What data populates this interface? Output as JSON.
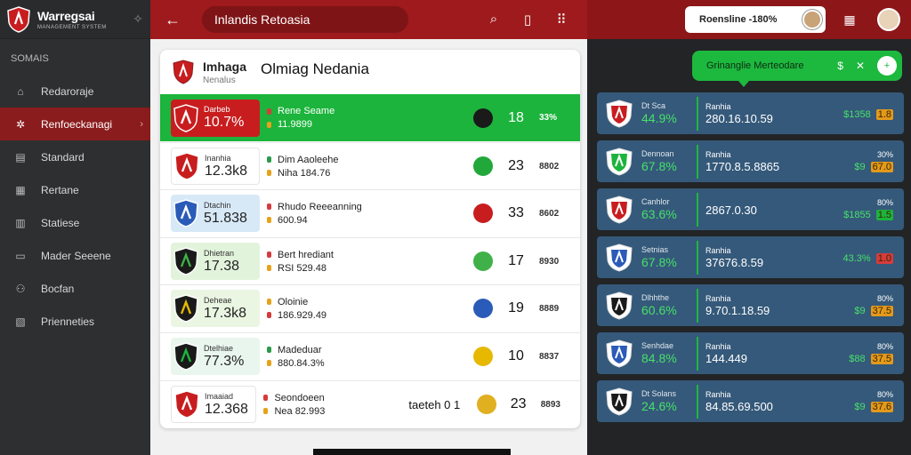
{
  "app": {
    "title": "Warregsai",
    "subtitle": "MANAGEMENT SYSTEM",
    "pulse_icon": "activity-icon"
  },
  "sidebar": {
    "section": "SOMAIS",
    "items": [
      {
        "label": "Redaroraje",
        "icon": "home-icon"
      },
      {
        "label": "Renfoeckanagi",
        "icon": "settings-icon",
        "active": true
      },
      {
        "label": "Standard",
        "icon": "document-icon"
      },
      {
        "label": "Rertane",
        "icon": "calendar-icon"
      },
      {
        "label": "Statiese",
        "icon": "chart-icon"
      },
      {
        "label": "Mader Seeene",
        "icon": "bookmark-icon"
      },
      {
        "label": "Bocfan",
        "icon": "users-icon"
      },
      {
        "label": "Prienneties",
        "icon": "clipboard-icon"
      }
    ]
  },
  "topbar": {
    "back_icon": "arrow-left-icon",
    "search_text": "Inlandis Retoasia",
    "icons": [
      "search-icon",
      "bookmark-icon",
      "grid-icon"
    ]
  },
  "topright": {
    "pill_text": "Roensline -180%",
    "accent": "#9e1a1c"
  },
  "card": {
    "head_title": "Imhaga",
    "head_sub": "Nenalus",
    "head_main": "Olmiag Nedania",
    "rows": [
      {
        "box_small": "Darbeb",
        "box_big": "10.7%",
        "l1": "Rene Seame",
        "l2": "11.9899",
        "score": "18",
        "tail": "33%",
        "ball": "#1a1a1a",
        "highlight": true
      },
      {
        "box_small": "Inanhia",
        "box_big": "12.3k8",
        "l1": "Dim Aaoleehe",
        "l2": "Niha 184.76",
        "score": "23",
        "tail": "8802",
        "ball": "#22a83a"
      },
      {
        "box_small": "Dtachin",
        "box_big": "51.838",
        "l1": "Rhudo Reeeanning",
        "l2": "600.94",
        "score": "33",
        "tail": "8602",
        "ball": "#c81d1f"
      },
      {
        "box_small": "Dhietran",
        "box_big": "17.38",
        "l1": "Bert hrediant",
        "l2": "RSI 529.48",
        "score": "17",
        "tail": "8930",
        "ball": "#3fb148"
      },
      {
        "box_small": "Deheae",
        "box_big": "17.3k8",
        "l1": "Oloinie",
        "l2": "186.929.49",
        "score": "19",
        "tail": "8889",
        "ball": "#2b5bb8"
      },
      {
        "box_small": "Dtelhiae",
        "box_big": "77.3%",
        "l1": "Madeduar",
        "l2": "880.84.3%",
        "score": "10",
        "tail": "8837",
        "ball": "#e6b800"
      },
      {
        "box_small": "Imaaiad",
        "box_big": "12.368",
        "l1": "Seondoeen",
        "l2": "Nea 82.993",
        "score": "23",
        "tail": "8893",
        "ball": "#e0b020",
        "extra": "taeteh  0   1"
      }
    ]
  },
  "rpanel": {
    "pill_text": "Grinanglie Merteodare",
    "pill_icons": [
      "dollar-icon",
      "close-icon",
      "plus-icon"
    ],
    "cards": [
      {
        "s1": "Dt Sca",
        "b1": "44.9%",
        "s2": "Ranhia",
        "b2": "280.16.10.59",
        "s3": "",
        "v1": "$1358",
        "v2": "1.8",
        "accent": "orange"
      },
      {
        "s1": "Dennoan",
        "b1": "67.8%",
        "s2": "Ranhia",
        "b2": "1770.8.5.8865",
        "s3": "30%",
        "v1": "$9",
        "v2": "67.0",
        "accent": "orange"
      },
      {
        "s1": "Canhlor",
        "b1": "63.6%",
        "s2": "",
        "b2": "2867.0.30",
        "s3": "80%",
        "v1": "$1855",
        "v2": "1.5",
        "accent": "green"
      },
      {
        "s1": "Setnias",
        "b1": "67.8%",
        "s2": "Ranhia",
        "b2": "37676.8.59",
        "s3": "",
        "v1": "43.3%",
        "v2": "1.0",
        "accent": "red"
      },
      {
        "s1": "Dlhhthe",
        "b1": "60.6%",
        "s2": "Ranhia",
        "b2": "9.70.1.18.59",
        "s3": "80%",
        "v1": "$9",
        "v2": "37.5",
        "accent": "orange"
      },
      {
        "s1": "Senhdae",
        "b1": "84.8%",
        "s2": "Ranhia",
        "b2": "144.449",
        "s3": "80%",
        "v1": "$88",
        "v2": "37.5",
        "accent": "orange"
      },
      {
        "s1": "Dt Solans",
        "b1": "24.6%",
        "s2": "Ranhia",
        "b2": "84.85.69.500",
        "s3": "80%",
        "v1": "$9",
        "v2": "37.6",
        "accent": "orange"
      }
    ]
  }
}
